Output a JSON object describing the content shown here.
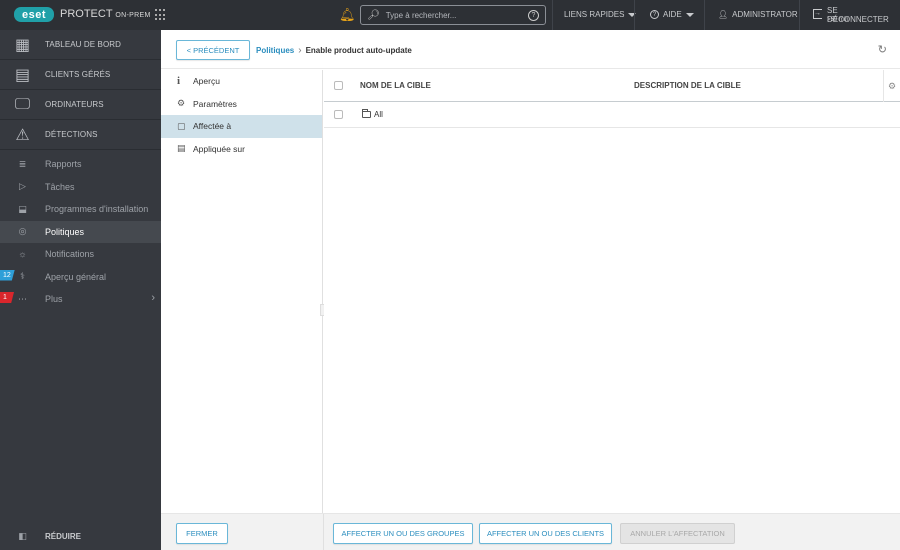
{
  "topbar": {
    "logo": "eset",
    "product_name": "PROTECT",
    "product_suffix": "ON-PREM",
    "search_placeholder": "Type à rechercher...",
    "quick_links": "LIENS RAPIDES",
    "help": "AIDE",
    "user": "ADMINISTRATOR",
    "logout": "SE DÉCONNECTER",
    "session_time": ">59 min",
    "icons": {
      "apps": "grid-icon",
      "notifications": "bell-icon",
      "search": "search-icon",
      "search_help": "question-icon",
      "help": "question-circle-icon",
      "user": "user-icon",
      "logout": "logout-icon"
    },
    "bell_color": "#e8a317"
  },
  "sidebar": {
    "main_items": [
      {
        "label": "TABLEAU DE BORD",
        "icon": "dashboard-icon"
      },
      {
        "label": "CLIENTS GÉRÉS",
        "icon": "building-icon"
      },
      {
        "label": "ORDINATEURS",
        "icon": "computers-icon"
      },
      {
        "label": "DÉTECTIONS",
        "icon": "warning-icon"
      }
    ],
    "sub_items": [
      {
        "label": "Rapports",
        "icon": "reports-icon"
      },
      {
        "label": "Tâches",
        "icon": "tasks-icon"
      },
      {
        "label": "Programmes d'installation",
        "icon": "installer-icon"
      },
      {
        "label": "Politiques",
        "icon": "policy-icon",
        "active": true
      },
      {
        "label": "Notifications",
        "icon": "notification-icon"
      },
      {
        "label": "Aperçu général",
        "icon": "status-icon",
        "badge": "12",
        "badge_color": "#2e9fd8"
      },
      {
        "label": "Plus",
        "icon": "more-icon",
        "badge": "1",
        "badge_color": "#d9262c"
      }
    ],
    "collapse_label": "RÉDUIRE"
  },
  "header": {
    "back_button": "< PRÉCÉDENT",
    "breadcrumb_parent": "Politiques",
    "breadcrumb_current": "Enable product auto-update"
  },
  "tabs": [
    {
      "label": "Aperçu",
      "icon": "info-icon"
    },
    {
      "label": "Paramètres",
      "icon": "settings-icon"
    },
    {
      "label": "Affectée à",
      "icon": "assigned-icon",
      "active": true
    },
    {
      "label": "Appliquée sur",
      "icon": "applied-icon"
    }
  ],
  "table": {
    "columns": [
      "NOM DE LA CIBLE",
      "DESCRIPTION DE LA CIBLE"
    ],
    "rows": [
      {
        "name": "All",
        "description": "",
        "type": "folder"
      }
    ]
  },
  "footer": {
    "close": "FERMER",
    "assign_groups": "AFFECTER UN OU DES GROUPES",
    "assign_clients": "AFFECTER UN OU DES CLIENTS",
    "unassign": "ANNULER L'AFFECTATION"
  }
}
